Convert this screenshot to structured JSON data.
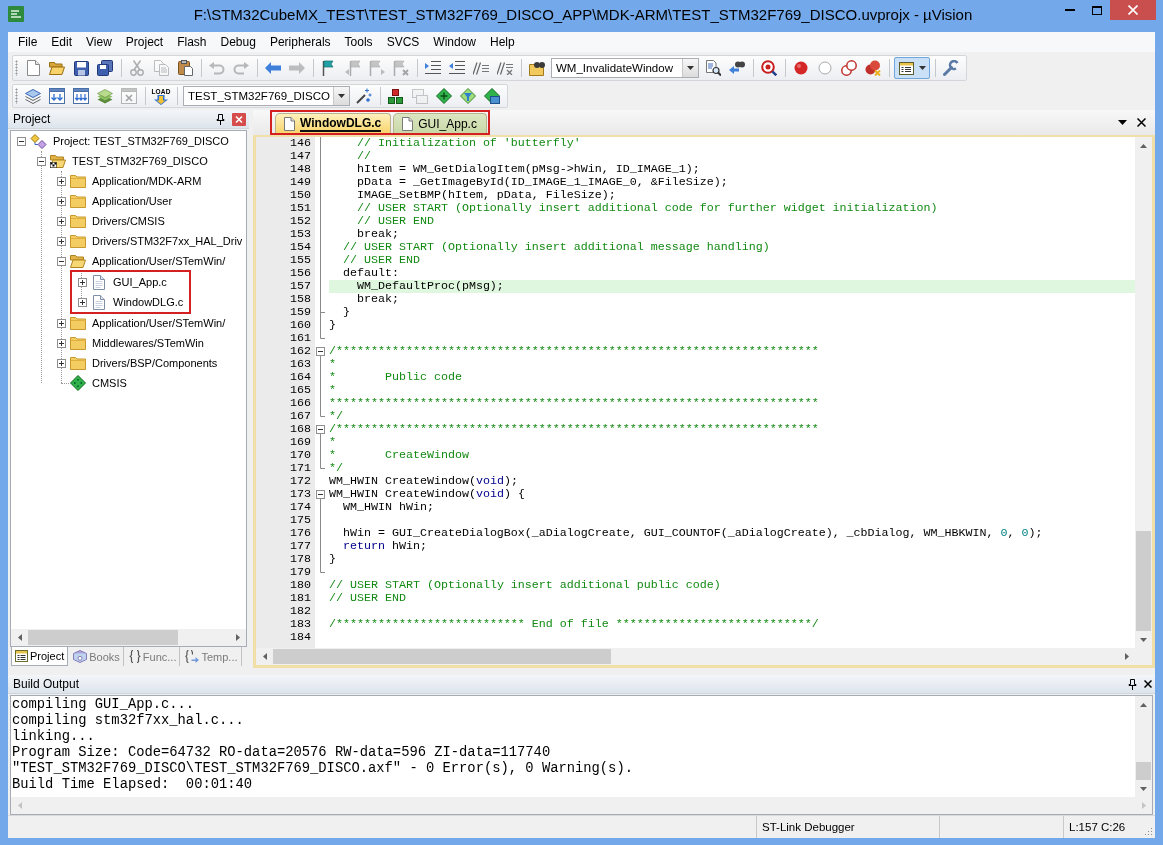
{
  "window": {
    "title": "F:\\STM32CubeMX_TEST\\TEST_STM32F769_DISCO_APP\\MDK-ARM\\TEST_STM32F769_DISCO.uvprojx - µVision"
  },
  "menu": [
    "File",
    "Edit",
    "View",
    "Project",
    "Flash",
    "Debug",
    "Peripherals",
    "Tools",
    "SVCS",
    "Window",
    "Help"
  ],
  "toolbars": [
    [
      [
        {
          "kind": "new",
          "disabled": false,
          "pressed": false
        },
        {
          "kind": "open",
          "disabled": false,
          "pressed": false
        },
        {
          "kind": "save",
          "disabled": false,
          "pressed": false
        },
        {
          "kind": "saveall",
          "disabled": false,
          "pressed": false
        }
      ],
      [
        {
          "kind": "cut",
          "disabled": true,
          "pressed": false
        },
        {
          "kind": "copy",
          "disabled": true,
          "pressed": false
        },
        {
          "kind": "paste",
          "disabled": false,
          "pressed": false
        }
      ],
      [
        {
          "kind": "undo",
          "disabled": true,
          "pressed": false
        },
        {
          "kind": "redo",
          "disabled": true,
          "pressed": false
        }
      ],
      [
        {
          "kind": "back",
          "disabled": false,
          "pressed": false
        },
        {
          "kind": "forward",
          "disabled": true,
          "pressed": false
        }
      ],
      [
        {
          "kind": "bookmark",
          "disabled": false,
          "pressed": false
        },
        {
          "kind": "prevbookmark",
          "disabled": true,
          "pressed": false
        },
        {
          "kind": "nextbookmark",
          "disabled": true,
          "pressed": false
        },
        {
          "kind": "clearbookmarks",
          "disabled": true,
          "pressed": false
        }
      ],
      [
        {
          "kind": "indent",
          "disabled": false,
          "pressed": false
        },
        {
          "kind": "unindent",
          "disabled": false,
          "pressed": false
        },
        {
          "kind": "comment",
          "disabled": false,
          "pressed": false
        },
        {
          "kind": "uncomment",
          "disabled": false,
          "pressed": false
        }
      ],
      [
        {
          "kind": "findfiles",
          "disabled": false,
          "pressed": false
        },
        {
          "kind": "combo",
          "value": "WM_InvalidateWindow",
          "disabled": false
        },
        {
          "kind": "find",
          "disabled": false,
          "pressed": false
        },
        {
          "kind": "incfind",
          "disabled": false,
          "pressed": false
        }
      ],
      [
        {
          "kind": "debug",
          "disabled": false,
          "pressed": false
        }
      ],
      [
        {
          "kind": "breakpoint",
          "disabled": false,
          "pressed": false
        },
        {
          "kind": "enablebreakpoint",
          "disabled": false,
          "pressed": false
        },
        {
          "kind": "disablebreakpoints",
          "disabled": false,
          "pressed": false
        },
        {
          "kind": "killbreakpoints",
          "disabled": false,
          "pressed": false
        }
      ],
      [
        {
          "kind": "layout",
          "disabled": false,
          "pressed": true
        }
      ],
      [
        {
          "kind": "configure",
          "disabled": false,
          "pressed": false
        }
      ]
    ],
    [
      [
        {
          "kind": "translate",
          "disabled": false,
          "pressed": false
        },
        {
          "kind": "build",
          "disabled": false,
          "pressed": false
        },
        {
          "kind": "rebuild",
          "disabled": false,
          "pressed": false
        },
        {
          "kind": "batchbuild",
          "disabled": false,
          "pressed": false
        },
        {
          "kind": "stopbuild",
          "disabled": true,
          "pressed": false
        }
      ],
      [
        {
          "kind": "download",
          "label": "LOAD",
          "disabled": false,
          "pressed": false
        }
      ],
      [
        {
          "kind": "combo",
          "value": "TEST_STM32F769_DISCO",
          "disabled": false
        },
        {
          "kind": "options",
          "disabled": false,
          "pressed": false
        }
      ],
      [
        {
          "kind": "manage",
          "disabled": false,
          "pressed": false
        },
        {
          "kind": "multiproject",
          "disabled": true,
          "pressed": false
        },
        {
          "kind": "rte",
          "disabled": false,
          "pressed": false
        },
        {
          "kind": "packinstaller",
          "disabled": false,
          "pressed": false
        },
        {
          "kind": "packs",
          "disabled": false,
          "pressed": false
        }
      ]
    ]
  ],
  "project_panel": {
    "title": "Project",
    "tree": [
      {
        "label": "Project: TEST_STM32F769_DISCO",
        "kind": "project",
        "expanded": true,
        "children": [
          {
            "label": "TEST_STM32F769_DISCO",
            "kind": "target",
            "expanded": true,
            "children": [
              {
                "label": "Application/MDK-ARM",
                "kind": "group",
                "expanded": false
              },
              {
                "label": "Application/User",
                "kind": "group",
                "expanded": false
              },
              {
                "label": "Drivers/CMSIS",
                "kind": "group",
                "expanded": false
              },
              {
                "label": "Drivers/STM32F7xx_HAL_Driv",
                "kind": "group",
                "expanded": false
              },
              {
                "label": "Application/User/STemWin/",
                "kind": "group",
                "expanded": true,
                "children": [
                  {
                    "label": "GUI_App.c",
                    "kind": "file",
                    "expanded": false,
                    "outlined": true
                  },
                  {
                    "label": "WindowDLG.c",
                    "kind": "file",
                    "expanded": false,
                    "outlined": true
                  }
                ]
              },
              {
                "label": "Application/User/STemWin/",
                "kind": "group",
                "expanded": false
              },
              {
                "label": "Middlewares/STemWin",
                "kind": "group",
                "expanded": false
              },
              {
                "label": "Drivers/BSP/Components",
                "kind": "group",
                "expanded": false
              },
              {
                "label": "CMSIS",
                "kind": "component"
              }
            ]
          }
        ]
      }
    ],
    "tabs": [
      {
        "label": "Project",
        "kind": "project",
        "selected": true
      },
      {
        "label": "Books",
        "kind": "books",
        "selected": false
      },
      {
        "label": "Func...",
        "kind": "functions",
        "selected": false
      },
      {
        "label": "Temp...",
        "kind": "templates",
        "selected": false
      }
    ]
  },
  "editor": {
    "tabs": [
      {
        "label": "WindowDLG.c",
        "selected": true,
        "outlined": true
      },
      {
        "label": "GUI_App.c",
        "selected": false,
        "outlined": true
      }
    ],
    "lines": [
      {
        "number": "146",
        "fold": {
          "kind": "line"
        },
        "highlighted": false,
        "code": [
          {
            "kind": "comment",
            "text": "    // Initialization of 'butterfly'"
          }
        ]
      },
      {
        "number": "147",
        "fold": {
          "kind": "line"
        },
        "highlighted": false,
        "code": [
          {
            "kind": "comment",
            "text": "    //"
          }
        ]
      },
      {
        "number": "148",
        "fold": {
          "kind": "line"
        },
        "highlighted": false,
        "code": [
          {
            "kind": "plain",
            "text": "    hItem = WM_GetDialogItem(pMsg->hWin, ID_IMAGE_1);"
          }
        ]
      },
      {
        "number": "149",
        "fold": {
          "kind": "line"
        },
        "highlighted": false,
        "code": [
          {
            "kind": "plain",
            "text": "    pData = _GetImageById(ID_IMAGE_1_IMAGE_0, &FileSize);"
          }
        ]
      },
      {
        "number": "150",
        "fold": {
          "kind": "line"
        },
        "highlighted": false,
        "code": [
          {
            "kind": "plain",
            "text": "    IMAGE_SetBMP(hItem, pData, FileSize);"
          }
        ]
      },
      {
        "number": "151",
        "fold": {
          "kind": "line"
        },
        "highlighted": false,
        "code": [
          {
            "kind": "comment",
            "text": "    // USER START (Optionally insert additional code for further widget initialization)"
          }
        ]
      },
      {
        "number": "152",
        "fold": {
          "kind": "line"
        },
        "highlighted": false,
        "code": [
          {
            "kind": "comment",
            "text": "    // USER END"
          }
        ]
      },
      {
        "number": "153",
        "fold": {
          "kind": "line"
        },
        "highlighted": false,
        "code": [
          {
            "kind": "plain",
            "text": "    break;"
          }
        ]
      },
      {
        "number": "154",
        "fold": {
          "kind": "line"
        },
        "highlighted": false,
        "code": [
          {
            "kind": "comment",
            "text": "  // USER START (Optionally insert additional message handling)"
          }
        ]
      },
      {
        "number": "155",
        "fold": {
          "kind": "line"
        },
        "highlighted": false,
        "code": [
          {
            "kind": "comment",
            "text": "  // USER END"
          }
        ]
      },
      {
        "number": "156",
        "fold": {
          "kind": "line"
        },
        "highlighted": false,
        "code": [
          {
            "kind": "plain",
            "text": "  default:"
          }
        ]
      },
      {
        "number": "157",
        "fold": {
          "kind": "line"
        },
        "highlighted": true,
        "code": [
          {
            "kind": "plain",
            "text": "    WM_DefaultProc(pMsg);"
          }
        ]
      },
      {
        "number": "158",
        "fold": {
          "kind": "line"
        },
        "highlighted": false,
        "code": [
          {
            "kind": "plain",
            "text": "    break;"
          }
        ]
      },
      {
        "number": "159",
        "fold": {
          "kind": "tee"
        },
        "highlighted": false,
        "code": [
          {
            "kind": "plain",
            "text": "  }"
          }
        ]
      },
      {
        "number": "160",
        "fold": {
          "kind": "line"
        },
        "highlighted": false,
        "code": [
          {
            "kind": "plain",
            "text": "}"
          }
        ]
      },
      {
        "number": "161",
        "fold": {
          "kind": "end"
        },
        "highlighted": false
      },
      {
        "number": "162",
        "fold": {
          "kind": "open"
        },
        "highlighted": false,
        "code": [
          {
            "kind": "comment",
            "text": "/*********************************************************************"
          }
        ]
      },
      {
        "number": "163",
        "fold": {
          "kind": "line"
        },
        "highlighted": false,
        "code": [
          {
            "kind": "comment",
            "text": "*"
          }
        ]
      },
      {
        "number": "164",
        "fold": {
          "kind": "line"
        },
        "highlighted": false,
        "code": [
          {
            "kind": "comment",
            "text": "*       Public code"
          }
        ]
      },
      {
        "number": "165",
        "fold": {
          "kind": "line"
        },
        "highlighted": false,
        "code": [
          {
            "kind": "comment",
            "text": "*"
          }
        ]
      },
      {
        "number": "166",
        "fold": {
          "kind": "line"
        },
        "highlighted": false,
        "code": [
          {
            "kind": "comment",
            "text": "**********************************************************************"
          }
        ]
      },
      {
        "number": "167",
        "fold": {
          "kind": "end"
        },
        "highlighted": false,
        "code": [
          {
            "kind": "comment",
            "text": "*/"
          }
        ]
      },
      {
        "number": "168",
        "fold": {
          "kind": "open"
        },
        "highlighted": false,
        "code": [
          {
            "kind": "comment",
            "text": "/*********************************************************************"
          }
        ]
      },
      {
        "number": "169",
        "fold": {
          "kind": "line"
        },
        "highlighted": false,
        "code": [
          {
            "kind": "comment",
            "text": "*"
          }
        ]
      },
      {
        "number": "170",
        "fold": {
          "kind": "line"
        },
        "highlighted": false,
        "code": [
          {
            "kind": "comment",
            "text": "*       CreateWindow"
          }
        ]
      },
      {
        "number": "171",
        "fold": {
          "kind": "end"
        },
        "highlighted": false,
        "code": [
          {
            "kind": "comment",
            "text": "*/"
          }
        ]
      },
      {
        "number": "172",
        "highlighted": false,
        "code": [
          {
            "kind": "plain",
            "text": "WM_HWIN CreateWindow("
          },
          {
            "kind": "keyword",
            "text": "void"
          },
          {
            "kind": "plain",
            "text": ");"
          }
        ]
      },
      {
        "number": "173",
        "fold": {
          "kind": "open"
        },
        "highlighted": false,
        "code": [
          {
            "kind": "plain",
            "text": "WM_HWIN CreateWindow("
          },
          {
            "kind": "keyword",
            "text": "void"
          },
          {
            "kind": "plain",
            "text": ") {"
          }
        ]
      },
      {
        "number": "174",
        "fold": {
          "kind": "line"
        },
        "highlighted": false,
        "code": [
          {
            "kind": "plain",
            "text": "  WM_HWIN hWin;"
          }
        ]
      },
      {
        "number": "175",
        "fold": {
          "kind": "line"
        },
        "highlighted": false
      },
      {
        "number": "176",
        "fold": {
          "kind": "line"
        },
        "highlighted": false,
        "code": [
          {
            "kind": "plain",
            "text": "  hWin = GUI_CreateDialogBox(_aDialogCreate, GUI_COUNTOF(_aDialogCreate), _cbDialog, WM_HBKWIN, "
          },
          {
            "kind": "number",
            "text": "0"
          },
          {
            "kind": "plain",
            "text": ", "
          },
          {
            "kind": "number",
            "text": "0"
          },
          {
            "kind": "plain",
            "text": ");"
          }
        ]
      },
      {
        "number": "177",
        "fold": {
          "kind": "line"
        },
        "highlighted": false,
        "code": [
          {
            "kind": "keyword",
            "text": "  return"
          },
          {
            "kind": "plain",
            "text": " hWin;"
          }
        ]
      },
      {
        "number": "178",
        "fold": {
          "kind": "line"
        },
        "highlighted": false,
        "code": [
          {
            "kind": "plain",
            "text": "}"
          }
        ]
      },
      {
        "number": "179",
        "fold": {
          "kind": "end"
        },
        "highlighted": false
      },
      {
        "number": "180",
        "highlighted": false,
        "code": [
          {
            "kind": "comment",
            "text": "// USER START (Optionally insert additional public code)"
          }
        ]
      },
      {
        "number": "181",
        "highlighted": false,
        "code": [
          {
            "kind": "comment",
            "text": "// USER END"
          }
        ]
      },
      {
        "number": "182",
        "highlighted": false
      },
      {
        "number": "183",
        "highlighted": false,
        "code": [
          {
            "kind": "comment",
            "text": "/*************************** End of file ****************************/"
          }
        ]
      },
      {
        "number": "184",
        "highlighted": false
      }
    ]
  },
  "build_output": {
    "title": "Build Output",
    "lines": [
      "compiling GUI_App.c...",
      "compiling stm32f7xx_hal.c...",
      "linking...",
      "Program Size: Code=64732 RO-data=20576 RW-data=596 ZI-data=117740",
      "\"TEST_STM32F769_DISCO\\TEST_STM32F769_DISCO.axf\" - 0 Error(s), 0 Warning(s).",
      "Build Time Elapsed:  00:01:40"
    ]
  },
  "status_bar": {
    "debugger": "ST-Link Debugger",
    "position": "L:157 C:26"
  }
}
